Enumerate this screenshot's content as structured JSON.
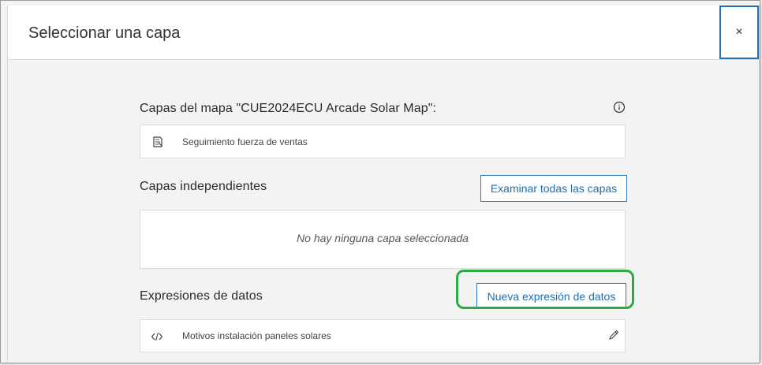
{
  "dialog": {
    "title": "Seleccionar una capa",
    "close_label": "×"
  },
  "map_layers": {
    "heading": "Capas del mapa \"CUE2024ECU Arcade Solar Map\":",
    "items": [
      {
        "label": "Seguimiento fuerza de ventas",
        "icon": "map-layer-icon"
      }
    ]
  },
  "standalone_layers": {
    "heading": "Capas independientes",
    "browse_button_label": "Examinar todas las capas",
    "empty_message": "No hay ninguna capa seleccionada"
  },
  "data_expressions": {
    "heading": "Expresiones de datos",
    "new_button_label": "Nueva expresión de datos",
    "items": [
      {
        "label": "Motivos instalación paneles solares",
        "icon": "code-icon",
        "action_icon": "pencil-icon"
      }
    ]
  },
  "colors": {
    "accent": "#1f6fb1",
    "highlight": "#2fa846"
  }
}
